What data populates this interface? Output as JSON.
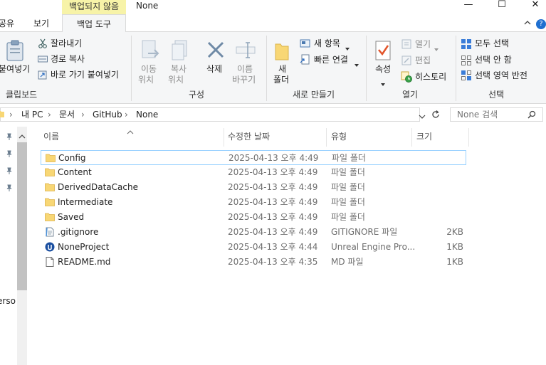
{
  "window": {
    "context_tab": "백업되지 않음",
    "title": "None",
    "minimize": "—",
    "maximize": "☐",
    "close": "✕"
  },
  "tabs": {
    "share": "공유",
    "view": "보기",
    "backup_tools": "백업 도구",
    "help": "?"
  },
  "ribbon": {
    "clipboard": {
      "group": "클립보드",
      "paste": "붙여넣기",
      "cut": "잘라내기",
      "copy_path": "경로 복사",
      "paste_shortcut": "바로 가기 붙여넣기"
    },
    "organize": {
      "group": "구성",
      "move_to_1": "이동",
      "move_to_2": "위치",
      "copy_to_1": "복사",
      "copy_to_2": "위치",
      "delete": "삭제",
      "rename_1": "이름",
      "rename_2": "바꾸기"
    },
    "new": {
      "group": "새로 만들기",
      "new_folder_1": "새",
      "new_folder_2": "폴더",
      "new_item": "새 항목",
      "easy_access": "빠른 연결"
    },
    "open": {
      "group": "열기",
      "properties": "속성",
      "open": "열기",
      "edit": "편집",
      "history": "히스토리"
    },
    "select": {
      "group": "선택",
      "select_all": "모두 선택",
      "select_none": "선택 안 함",
      "invert": "선택 영역 반전"
    }
  },
  "address": {
    "crumbs": [
      "내 PC",
      "문서",
      "GitHub",
      "None"
    ],
    "search_placeholder": "None 검색"
  },
  "nav": {
    "partial_label": "erso"
  },
  "columns": {
    "name": "이름",
    "date": "수정한 날짜",
    "type": "유형",
    "size": "크기"
  },
  "files": [
    {
      "name": "Config",
      "date": "2025-04-13 오후 4:49",
      "type": "파일 폴더",
      "size": "",
      "icon": "folder-icon"
    },
    {
      "name": "Content",
      "date": "2025-04-13 오후 4:49",
      "type": "파일 폴더",
      "size": "",
      "icon": "folder-icon"
    },
    {
      "name": "DerivedDataCache",
      "date": "2025-04-13 오후 4:49",
      "type": "파일 폴더",
      "size": "",
      "icon": "folder-icon"
    },
    {
      "name": "Intermediate",
      "date": "2025-04-13 오후 4:49",
      "type": "파일 폴더",
      "size": "",
      "icon": "folder-icon"
    },
    {
      "name": "Saved",
      "date": "2025-04-13 오후 4:49",
      "type": "파일 폴더",
      "size": "",
      "icon": "folder-icon"
    },
    {
      "name": ".gitignore",
      "date": "2025-04-13 오후 4:49",
      "type": "GITIGNORE 파일",
      "size": "2KB",
      "icon": "text-file-icon"
    },
    {
      "name": "NoneProject",
      "date": "2025-04-13 오후 4:44",
      "type": "Unreal Engine Pro...",
      "size": "1KB",
      "icon": "unreal-engine-icon"
    },
    {
      "name": "README.md",
      "date": "2025-04-13 오후 4:35",
      "type": "MD 파일",
      "size": "1KB",
      "icon": "document-icon"
    }
  ],
  "colors": {
    "context_tab": "#f7f3a8",
    "folder": "#f8d775",
    "selection_border": "#99d1ff",
    "accent_blue": "#1e6fd0"
  }
}
